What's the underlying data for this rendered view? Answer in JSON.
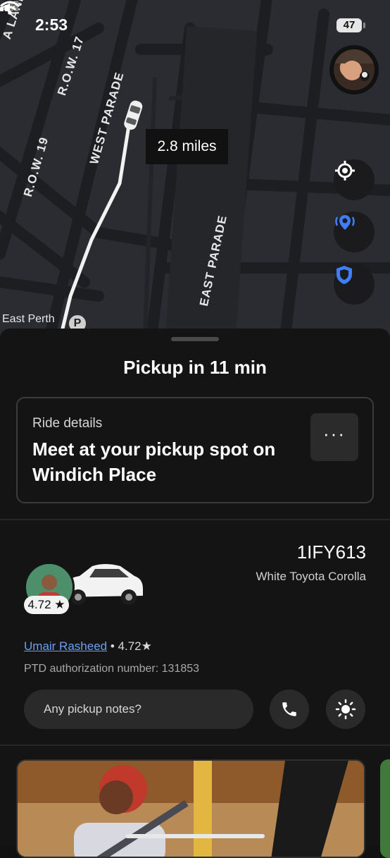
{
  "status_bar": {
    "time": "2:53",
    "battery": "47",
    "icons": [
      "location-arrow-icon",
      "cellular-signal-icon",
      "wifi-icon",
      "battery-icon"
    ]
  },
  "map": {
    "streets": [
      "R.O.W. 17",
      "WEST PARADE",
      "R.O.W. 19",
      "EAST PARADE",
      "A LANE"
    ],
    "place_label": "East Perth",
    "parking_badge": "P",
    "distance": "2.8 miles",
    "buttons": [
      "recenter-icon",
      "share-location-icon",
      "safety-shield-icon"
    ],
    "colors": {
      "background": "#2b2c31",
      "road": "#1f2024",
      "route": "#f2f2f2",
      "accent": "#3f7ef6"
    }
  },
  "sheet": {
    "pickup_title": "Pickup in 11 min",
    "ride_details": {
      "label": "Ride details",
      "message": "Meet at your pickup spot on Windich Place",
      "more_label": "···"
    },
    "driver": {
      "plate": "1IFY613",
      "car_model": "White Toyota Corolla",
      "rating": "4.72 ★",
      "name": "Umair Rasheed",
      "rating_inline": "• 4.72★",
      "authorization": "PTD authorization number: 131853"
    },
    "notes_placeholder": "Any pickup notes?",
    "actions": [
      "phone-icon",
      "brightness-icon"
    ]
  }
}
